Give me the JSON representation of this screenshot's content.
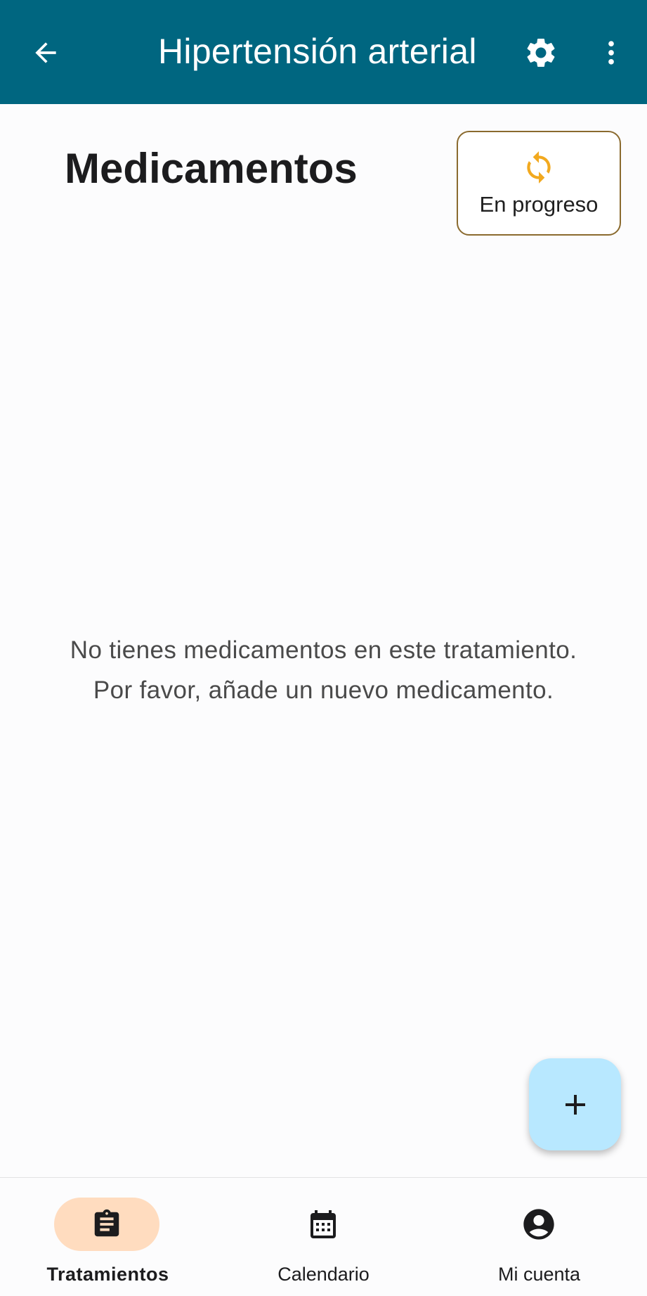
{
  "app_bar": {
    "title": "Hipertensión arterial",
    "back_icon": "arrow-left-icon",
    "settings_icon": "gear-icon",
    "more_icon": "more-vertical-icon",
    "background_color": "#006680"
  },
  "header": {
    "title": "Medicamentos",
    "status": {
      "label": "En progreso",
      "icon": "sync-icon",
      "icon_color": "#f2a91f",
      "border_color": "#8a6a2e"
    }
  },
  "empty_state": {
    "message": "No tienes medicamentos en este tratamiento. Por favor, añade un nuevo medicamento."
  },
  "fab": {
    "icon": "plus-icon",
    "color": "#b8e8ff"
  },
  "bottom_nav": {
    "items": [
      {
        "label": "Tratamientos",
        "icon": "clipboard-icon",
        "active": true
      },
      {
        "label": "Calendario",
        "icon": "calendar-icon",
        "active": false
      },
      {
        "label": "Mi cuenta",
        "icon": "account-circle-icon",
        "active": false
      }
    ],
    "active_indicator_color": "#ffdcbf"
  }
}
